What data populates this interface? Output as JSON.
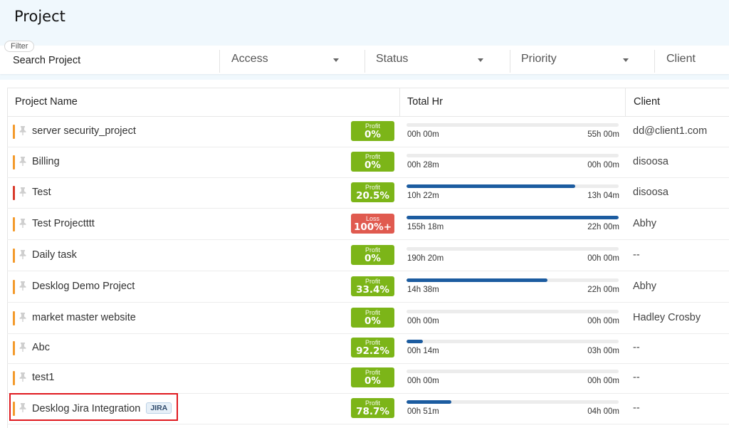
{
  "page": {
    "title": "Project"
  },
  "filters": {
    "chip_label": "Filter",
    "search_label": "Search Project",
    "access_label": "Access",
    "status_label": "Status",
    "priority_label": "Priority",
    "client_label": "Client"
  },
  "table": {
    "headers": {
      "project_name": "Project Name",
      "total_hr": "Total Hr",
      "client": "Client"
    },
    "rows": [
      {
        "name": "server security_project",
        "priority_color": "#f39a2b",
        "badge_label": "Profit",
        "badge_value": "0%",
        "badge_type": "profit",
        "spent": "00h 00m",
        "allocated": "55h 00m",
        "progress": 0.0,
        "client": "dd@client1.com"
      },
      {
        "name": "Billing",
        "priority_color": "#f39a2b",
        "badge_label": "Profit",
        "badge_value": "0%",
        "badge_type": "profit",
        "spent": "00h 28m",
        "allocated": "00h 00m",
        "progress": 0.0,
        "client": "disoosa"
      },
      {
        "name": "Test",
        "priority_color": "#d93a2b",
        "badge_label": "Profit",
        "badge_value": "20.5%",
        "badge_type": "profit",
        "spent": "10h 22m",
        "allocated": "13h 04m",
        "progress": 0.795,
        "client": "disoosa"
      },
      {
        "name": "Test Projectttt",
        "priority_color": "#f39a2b",
        "badge_label": "Loss",
        "badge_value": "100%+",
        "badge_type": "loss",
        "spent": "155h 18m",
        "allocated": "22h 00m",
        "progress": 1.0,
        "client": "Abhy"
      },
      {
        "name": "Daily task",
        "priority_color": "#f39a2b",
        "badge_label": "Profit",
        "badge_value": "0%",
        "badge_type": "profit",
        "spent": "190h 20m",
        "allocated": "00h 00m",
        "progress": 0.0,
        "client": "--"
      },
      {
        "name": "Desklog Demo Project",
        "priority_color": "#f39a2b",
        "badge_label": "Profit",
        "badge_value": "33.4%",
        "badge_type": "profit",
        "spent": "14h 38m",
        "allocated": "22h 00m",
        "progress": 0.665,
        "client": "Abhy"
      },
      {
        "name": "market master website",
        "priority_color": "#f39a2b",
        "badge_label": "Profit",
        "badge_value": "0%",
        "badge_type": "profit",
        "spent": "00h 00m",
        "allocated": "00h 00m",
        "progress": 0.0,
        "client": "Hadley Crosby"
      },
      {
        "name": "Abc",
        "priority_color": "#f39a2b",
        "badge_label": "Profit",
        "badge_value": "92.2%",
        "badge_type": "profit",
        "spent": "00h 14m",
        "allocated": "03h 00m",
        "progress": 0.078,
        "client": "--"
      },
      {
        "name": "test1",
        "priority_color": "#f39a2b",
        "badge_label": "Profit",
        "badge_value": "0%",
        "badge_type": "profit",
        "spent": "00h 00m",
        "allocated": "00h 00m",
        "progress": 0.0,
        "client": "--"
      },
      {
        "name": "Desklog Jira Integration",
        "tag": "JIRA",
        "priority_color": "#f39a2b",
        "badge_label": "Profit",
        "badge_value": "78.7%",
        "badge_type": "profit",
        "spent": "00h 51m",
        "allocated": "04h 00m",
        "progress": 0.213,
        "client": "--",
        "highlighted": true
      }
    ]
  },
  "colors": {
    "profit": "#7cb518",
    "loss": "#e05a4f",
    "progress": "#1c5ca0",
    "highlight": "#e0191f"
  }
}
